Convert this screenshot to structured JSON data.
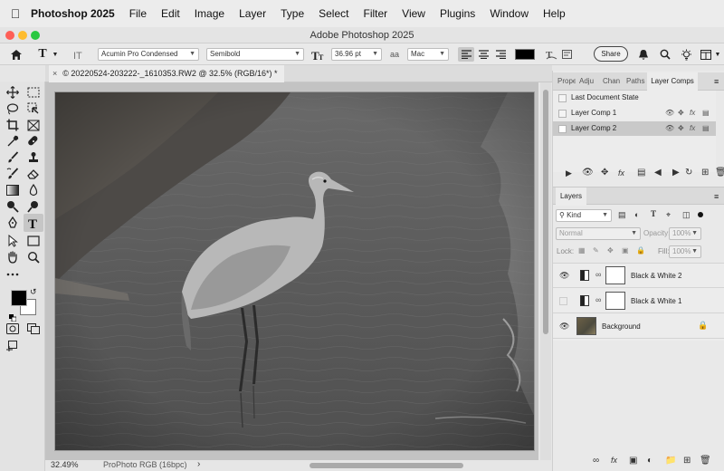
{
  "menubar": {
    "app": "Photoshop 2025",
    "items": [
      "File",
      "Edit",
      "Image",
      "Layer",
      "Type",
      "Select",
      "Filter",
      "View",
      "Plugins",
      "Window",
      "Help"
    ]
  },
  "window": {
    "title": "Adobe Photoshop 2025"
  },
  "options": {
    "font_family": "Acumin Pro Condensed",
    "font_style": "Semibold",
    "font_size": "36.96 pt",
    "antialias": "Mac",
    "share_label": "Share",
    "aa_glyph": "aa",
    "text_icon": "T"
  },
  "document": {
    "tab_title": "20220524-203222-_1610353.RW2 @ 32.5% (RGB/16*) *",
    "close": "×"
  },
  "status": {
    "zoom": "32.49%",
    "profile": "ProPhoto RGB (16bpc)",
    "arrow": "›"
  },
  "layer_comps": {
    "tabs": [
      "Prope",
      "Adju",
      "Chan",
      "Paths",
      "Layer Comps"
    ],
    "rows": [
      "Last Document State",
      "Layer Comp 1",
      "Layer Comp 2"
    ],
    "row_icons": [
      "eye-icon",
      "move-icon",
      "fx-icon",
      "doc-icon"
    ]
  },
  "layers_panel": {
    "tab": "Layers",
    "kind_label": "Kind",
    "blend_mode": "Normal",
    "opacity_label": "Opacity:",
    "opacity_value": "100%",
    "lock_label": "Lock:",
    "fill_label": "Fill:",
    "fill_value": "100%",
    "layers": [
      {
        "name": "Black & White 2",
        "visible": true
      },
      {
        "name": "Black & White 1",
        "visible": false
      },
      {
        "name": "Background",
        "visible": true,
        "locked": true
      }
    ]
  },
  "colors": {
    "accent": "#0f64d2",
    "fg": "#000000",
    "bg": "#ffffff",
    "active_comp": "#c9c9c9"
  }
}
